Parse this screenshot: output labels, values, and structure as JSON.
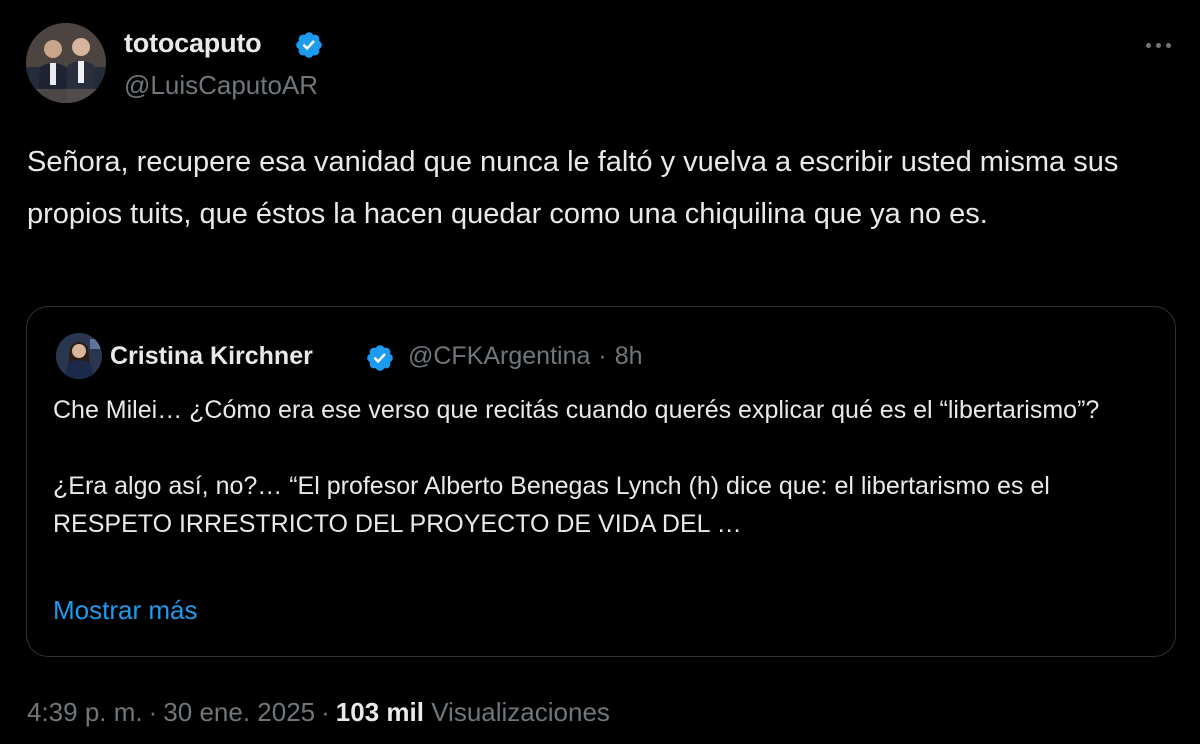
{
  "author": {
    "name": "totocaputo",
    "handle": "@LuisCaputoAR",
    "verified": true
  },
  "tweet": {
    "text": "Señora, recupere esa vanidad que nunca le faltó y vuelva a escribir usted misma sus propios tuits, que éstos la hacen quedar como una chiquilina que ya no es."
  },
  "quoted": {
    "name": "Cristina Kirchner",
    "handle": "@CFKArgentina",
    "separator": "·",
    "time_ago": "8h",
    "paragraph1": "Che Milei… ¿Cómo era ese verso que recitás cuando querés explicar qué es el “libertarismo”?",
    "paragraph2": "¿Era algo así, no?… “El profesor Alberto Benegas Lynch (h) dice que: el libertarismo es el RESPETO IRRESTRICTO DEL PROYECTO DE VIDA DEL …",
    "show_more": "Mostrar más"
  },
  "footer": {
    "time": "4:39 p. m.",
    "separator": "·",
    "date": "30 ene. 2025",
    "views_count": "103 mil",
    "views_label": "Visualizaciones"
  },
  "colors": {
    "background": "#000000",
    "text": "#e7e9ea",
    "secondary": "#71767b",
    "accent": "#1d9bf0",
    "border": "#2f3336",
    "verified_badge": "#1d9bf0"
  },
  "icons": {
    "verified": "verified-badge-icon",
    "more": "more-options-icon"
  }
}
